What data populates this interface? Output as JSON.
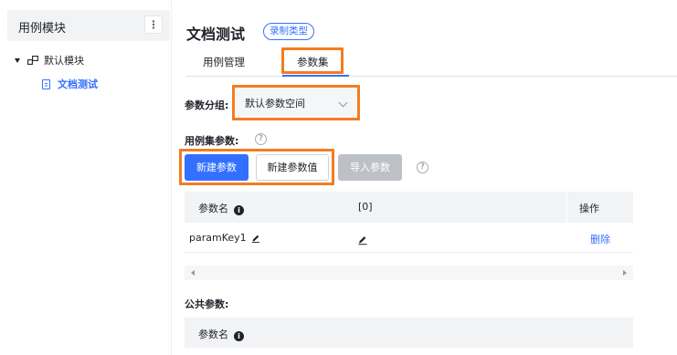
{
  "sidebar": {
    "title": "用例模块",
    "menu_icon": "more-vertical-icon",
    "tree": {
      "root_label": "默认模块",
      "child_label": "文档测试"
    }
  },
  "header": {
    "title": "文档测试",
    "type_tag": "录制类型"
  },
  "tabs": [
    {
      "label": "用例管理",
      "active": false
    },
    {
      "label": "参数集",
      "active": true
    }
  ],
  "param_group": {
    "label": "参数分组:",
    "selected": "默认参数空间"
  },
  "case_params": {
    "label": "用例集参数:",
    "buttons": {
      "new_param": "新建参数",
      "new_value": "新建参数值",
      "import": "导入参数"
    },
    "table": {
      "headers": [
        "参数名",
        "[0]",
        "操作"
      ],
      "rows": [
        {
          "key": "paramKey1",
          "action": "删除"
        }
      ]
    }
  },
  "public_params": {
    "label": "公共参数:",
    "table": {
      "headers": [
        "参数名"
      ]
    }
  },
  "colors": {
    "accent": "#3370ff",
    "highlight": "#f47c20",
    "disabled": "#bdc1c7"
  }
}
